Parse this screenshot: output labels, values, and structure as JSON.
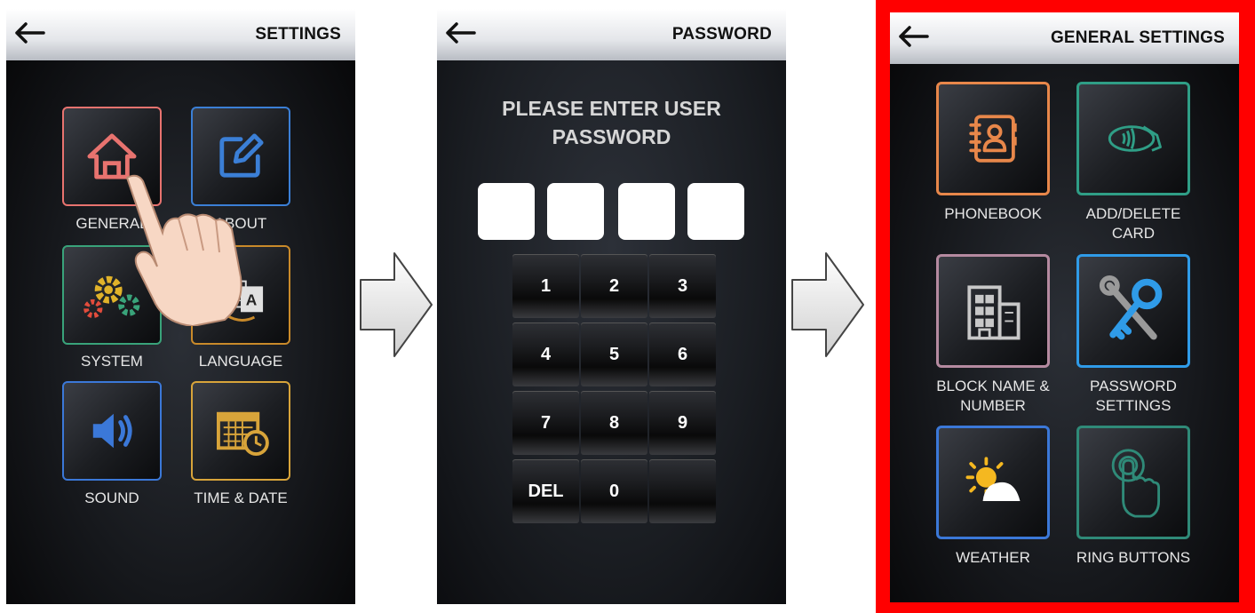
{
  "screen1": {
    "title": "SETTINGS",
    "tiles": [
      {
        "label": "GENERAL",
        "icon": "home-icon",
        "color": "#e8736f"
      },
      {
        "label": "ABOUT",
        "icon": "edit-icon",
        "color": "#3b7fd6"
      },
      {
        "label": "SYSTEM",
        "icon": "gears-icon",
        "color": "#39a37a"
      },
      {
        "label": "LANGUAGE",
        "icon": "language-icon",
        "color": "#c98a2a"
      },
      {
        "label": "SOUND",
        "icon": "speaker-icon",
        "color": "#3b78d8"
      },
      {
        "label": "TIME & DATE",
        "icon": "calendar-clock-icon",
        "color": "#d8a43a"
      }
    ]
  },
  "screen2": {
    "title": "PASSWORD",
    "prompt_line1": "PLEASE ENTER USER",
    "prompt_line2": "PASSWORD",
    "keys": [
      "1",
      "2",
      "3",
      "4",
      "5",
      "6",
      "7",
      "8",
      "9",
      "DEL",
      "0",
      ""
    ]
  },
  "screen3": {
    "title": "GENERAL SETTINGS",
    "tiles": [
      {
        "label": "PHONEBOOK",
        "icon": "phonebook-icon",
        "color": "#e8874a"
      },
      {
        "label": "ADD/DELETE CARD",
        "icon": "contactless-card-icon",
        "color": "#2f9e86"
      },
      {
        "label": "BLOCK NAME & NUMBER",
        "icon": "building-icon",
        "color": "#b58aa0"
      },
      {
        "label": "PASSWORD SETTINGS",
        "icon": "key-wrench-icon",
        "color": "#2f9be8"
      },
      {
        "label": "WEATHER",
        "icon": "weather-icon",
        "color": "#3b78d8"
      },
      {
        "label": "RING BUTTONS",
        "icon": "touch-icon",
        "color": "#2f8a78"
      }
    ]
  },
  "colors": {
    "highlight_frame": "#ff0000"
  }
}
